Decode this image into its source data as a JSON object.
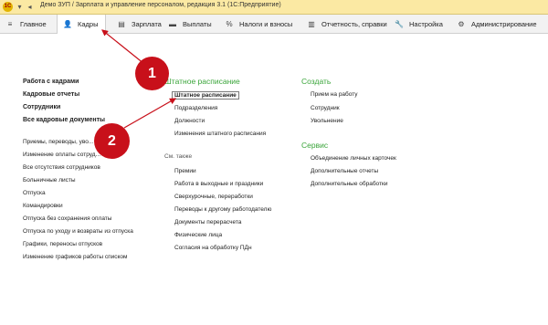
{
  "titlebar": {
    "title": "Демо ЗУП / Зарплата и управление персоналом, редакция 3.1  (1С:Предприятие)"
  },
  "menubar": {
    "items": [
      {
        "label": "Главное",
        "icon": "hamburger-icon"
      },
      {
        "label": "Кадры",
        "icon": "people-icon"
      },
      {
        "label": "Зарплата",
        "icon": "document-icon"
      },
      {
        "label": "Выплаты",
        "icon": "wallet-icon"
      },
      {
        "label": "Налоги и взносы",
        "icon": "percent-icon"
      },
      {
        "label": "Отчетность, справки",
        "icon": "report-icon"
      },
      {
        "label": "Настройка",
        "icon": "wrench-icon"
      },
      {
        "label": "Администрирование",
        "icon": "gear-icon"
      }
    ]
  },
  "left": {
    "bold_links": [
      "Работа с кадрами",
      "Кадровые отчеты",
      "Сотрудники",
      "Все кадровые документы"
    ],
    "links": [
      "Приемы, переводы, уво...",
      "Изменение оплаты сотруд...",
      "Все отсутствия сотрудников",
      "Больничные листы",
      "Отпуска",
      "Командировки",
      "Отпуска без сохранения оплаты",
      "Отпуска по уходу и возвраты из отпуска",
      "Графики, переносы отпусков",
      "Изменение графиков работы списком"
    ]
  },
  "middle": {
    "section_title": "Штатное расписание",
    "links": [
      "Штатное расписание",
      "Подразделения",
      "Должности",
      "Изменения штатного расписания"
    ],
    "see_also_label": "См. также",
    "see_also_links": [
      "Премии",
      "Работа в выходные и праздники",
      "Сверхурочные, переработки",
      "Переводы к другому работодателю",
      "Документы перерасчета",
      "Физические лица",
      "Согласия на обработку ПДн"
    ]
  },
  "right": {
    "create_title": "Создать",
    "create_links": [
      "Прием на работу",
      "Сотрудник",
      "Увольнение"
    ],
    "service_title": "Сервис",
    "service_links": [
      "Объединение личных карточек",
      "Дополнительные отчеты",
      "Дополнительные обработки"
    ]
  },
  "callouts": [
    "1",
    "2"
  ],
  "colors": {
    "accent": "#3aa53a",
    "callout": "#c8101a",
    "menubar": "#f2f2f2",
    "titlebar": "#fbe9a3"
  }
}
